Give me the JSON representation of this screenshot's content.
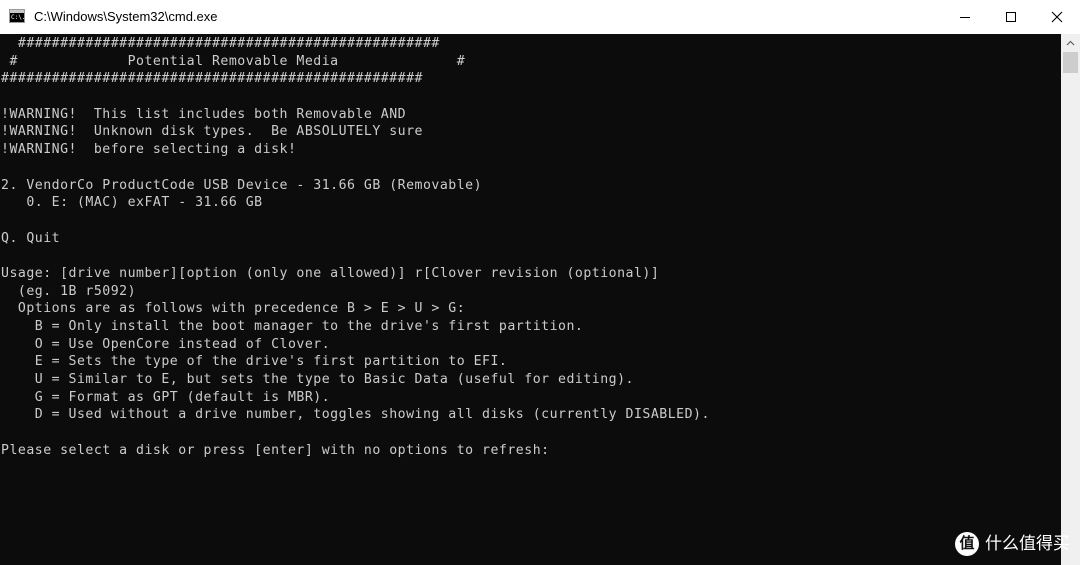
{
  "window": {
    "title": "C:\\Windows\\System32\\cmd.exe",
    "icon": "cmd-icon",
    "icon_text": "C:\\."
  },
  "controls": {
    "minimize": "minimize-icon",
    "maximize": "maximize-icon",
    "close": "close-icon"
  },
  "console": {
    "background": "#0c0c0c",
    "foreground": "#cccccc",
    "lines": [
      "  ##################################################",
      " #             Potential Removable Media              #",
      "##################################################",
      "",
      "!WARNING!  This list includes both Removable AND",
      "!WARNING!  Unknown disk types.  Be ABSOLUTELY sure",
      "!WARNING!  before selecting a disk!",
      "",
      "2. VendorCo ProductCode USB Device - 31.66 GB (Removable)",
      "   0. E: (MAC) exFAT - 31.66 GB",
      "",
      "Q. Quit",
      "",
      "Usage: [drive number][option (only one allowed)] r[Clover revision (optional)]",
      "  (eg. 1B r5092)",
      "  Options are as follows with precedence B > E > U > G:",
      "    B = Only install the boot manager to the drive's first partition.",
      "    O = Use OpenCore instead of Clover.",
      "    E = Sets the type of the drive's first partition to EFI.",
      "    U = Similar to E, but sets the type to Basic Data (useful for editing).",
      "    G = Format as GPT (default is MBR).",
      "    D = Used without a drive number, toggles showing all disks (currently DISABLED).",
      "",
      "Please select a disk or press [enter] with no options to refresh:"
    ]
  },
  "watermark": {
    "logo": "值",
    "text": "什么值得买"
  }
}
